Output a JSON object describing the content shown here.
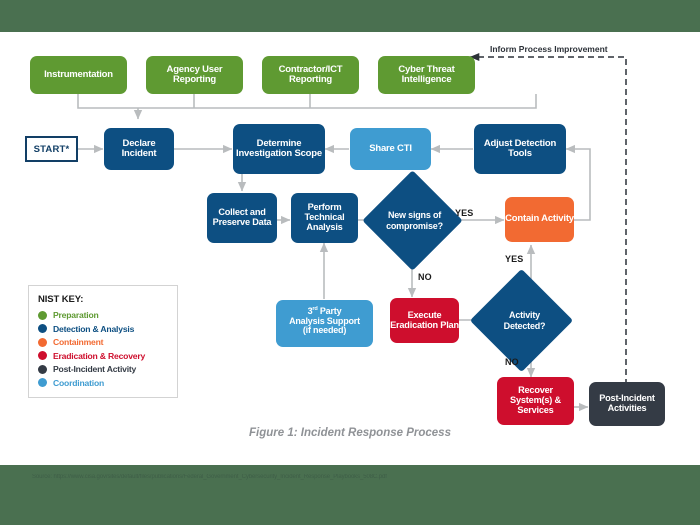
{
  "figure": {
    "caption": "Figure 1: Incident Response Process",
    "source": "Source: https://www.cisa.gov/sites/default/files/publications/Federal_Government_Cybersecurity_Incident_Response_Playbooks_508C.pdf"
  },
  "colors": {
    "slide_background": "#4a7050",
    "content_background": "#ffffff",
    "preparation": "#5f9a32",
    "detection_analysis": "#0d4f82",
    "containment": "#f26a32",
    "eradication_recovery": "#ce0e2d",
    "post_incident": "#343b45",
    "coordination": "#3f9cd1",
    "connector": "#b9bcbe",
    "start_border": "#123f66"
  },
  "start": {
    "label": "START*"
  },
  "inputs": [
    {
      "label": "Instrumentation",
      "category": "preparation"
    },
    {
      "label": "Agency User Reporting",
      "category": "preparation"
    },
    {
      "label": "Contractor/ICT Reporting",
      "category": "preparation"
    },
    {
      "label": "Cyber Threat Intelligence",
      "category": "preparation"
    }
  ],
  "nodes": {
    "declare_incident": "Declare Incident",
    "determine_scope": "Determine Investigation Scope",
    "share_cti": "Share CTI",
    "adjust_detection_tools": "Adjust Detection Tools",
    "collect_preserve": "Collect and Preserve Data",
    "perform_analysis": "Perform Technical Analysis",
    "third_party_line1": "3",
    "third_party_sup": "rd",
    "third_party_line1b": " Party",
    "third_party_line2": "Analysis Support",
    "third_party_line3": "(if needed)",
    "contain_activity": "Contain Activity",
    "execute_eradication": "Execute Eradication Plan",
    "recover_systems": "Recover System(s) & Services",
    "post_incident_activities": "Post-Incident Activities"
  },
  "decisions": {
    "new_signs": "New signs of compromise?",
    "activity_detected": "Activity Detected?"
  },
  "edge_labels": {
    "new_signs_yes": "YES",
    "new_signs_no": "NO",
    "activity_yes": "YES",
    "activity_no": "NO"
  },
  "feedback": {
    "label": "Inform Process Improvement"
  },
  "legend": {
    "title": "NIST KEY:",
    "items": [
      {
        "label": "Preparation",
        "color": "#5f9a32"
      },
      {
        "label": "Detection & Analysis",
        "color": "#0d4f82"
      },
      {
        "label": "Containment",
        "color": "#f26a32"
      },
      {
        "label": "Eradication & Recovery",
        "color": "#ce0e2d"
      },
      {
        "label": "Post-Incident Activity",
        "color": "#343b45"
      },
      {
        "label": "Coordination",
        "color": "#3f9cd1"
      }
    ]
  }
}
